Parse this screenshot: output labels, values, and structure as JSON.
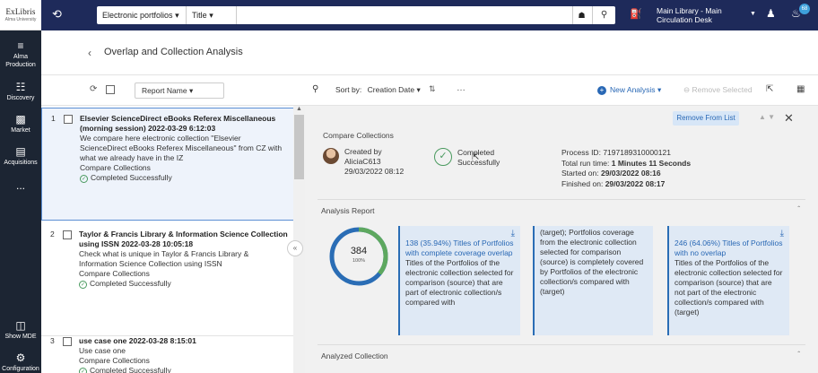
{
  "brand": {
    "name": "ExLibris",
    "subtitle": "Alma University"
  },
  "nav": {
    "items": [
      {
        "label": "Alma Production",
        "icon": "menu-star-icon"
      },
      {
        "label": "Discovery",
        "icon": "discovery-icon"
      },
      {
        "label": "Market",
        "icon": "market-icon"
      },
      {
        "label": "Acquisitions",
        "icon": "acquisitions-icon"
      },
      {
        "label": "...",
        "icon": "more-icon"
      },
      {
        "label": "Show MDE",
        "icon": "mde-icon"
      },
      {
        "label": "Configuration",
        "icon": "gear-icon"
      }
    ]
  },
  "topbar": {
    "search_scope": "Electronic portfolios",
    "search_field": "Title",
    "search_value": "",
    "location_line1": "Main Library - Main",
    "location_line2": "Circulation Desk",
    "notification_count": "68"
  },
  "page": {
    "title": "Overlap and Collection Analysis"
  },
  "toolbar": {
    "report_name_label": "Report Name",
    "sort_label": "Sort by:",
    "sort_value": "Creation Date",
    "new_analysis": "New Analysis",
    "remove_selected": "Remove Selected"
  },
  "list": {
    "items": [
      {
        "num": "1",
        "title": "Elsevier ScienceDirect eBooks Referex Miscellaneous (morning session) 2022-03-29 6:12:03",
        "desc": "We compare here electronic collection \"Elsevier ScienceDirect eBooks Referex Miscellaneous\" from CZ with what we already have in the IZ",
        "type": "Compare Collections",
        "status": "Completed Successfully"
      },
      {
        "num": "2",
        "title": "Taylor & Francis Library & Information Science Collection using ISSN 2022-03-28 10:05:18",
        "desc": "Check what is unique in Taylor & Francis Library & Information Science Collection using ISSN",
        "type": "Compare Collections",
        "status": "Completed Successfully"
      },
      {
        "num": "3",
        "title": "use case one 2022-03-28 8:15:01",
        "desc": "Use case one",
        "type": "Compare Collections",
        "status": "Completed Successfully"
      }
    ]
  },
  "details": {
    "remove_from_list": "Remove From List",
    "type": "Compare Collections",
    "created_by_label": "Created by",
    "creator": "AliciaC613",
    "created_date": "29/03/2022 08:12",
    "status_line1": "Completed",
    "status_line2": "Successfully",
    "process_id_label": "Process ID:",
    "process_id": "7197189310000121",
    "run_time_label": "Total run time:",
    "run_time": "1 Minutes 11 Seconds",
    "started_label": "Started on:",
    "started": "29/03/2022 08:16",
    "finished_label": "Finished on:",
    "finished": "29/03/2022 08:17",
    "analysis_report_label": "Analysis Report",
    "analyzed_collection_label": "Analyzed Collection",
    "donut": {
      "value": "384",
      "percent_label": "100%",
      "overlap_fraction": 0.3594
    },
    "cards": [
      {
        "headline": "138 (35.94%) Titles of Portfolios with complete coverage overlap",
        "text": "Titles of the Portfolios of the electronic collection selected for comparison (source) that are part of electronic collection/s compared with"
      },
      {
        "headline": "",
        "text": "(target); Portfolios coverage from the electronic collection selected for comparison (source) is completely covered by Portfolios of the electronic collection/s compared with (target)"
      },
      {
        "headline": "246 (64.06%) Titles of Portfolios with no overlap",
        "text": "Titles of the Portfolios of the electronic collection selected for comparison (source) that are not part of the electronic collection/s compared with (target)"
      }
    ]
  },
  "colors": {
    "topbar": "#1e2a5a",
    "leftnav": "#1c2533",
    "accent": "#2968b5",
    "success": "#4a9a5f"
  }
}
